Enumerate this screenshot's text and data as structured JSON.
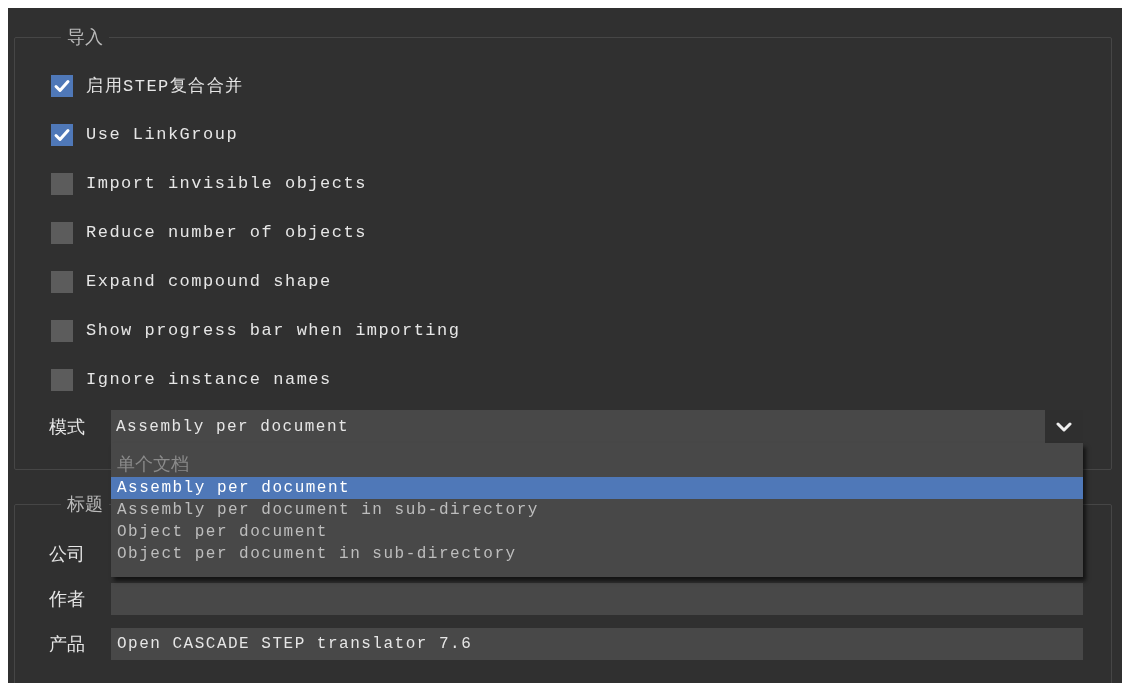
{
  "import": {
    "title": "导入",
    "options": [
      {
        "label": "启用STEP复合合并",
        "checked": true
      },
      {
        "label": "Use LinkGroup",
        "checked": true
      },
      {
        "label": "Import invisible objects",
        "checked": false
      },
      {
        "label": "Reduce number of objects",
        "checked": false
      },
      {
        "label": "Expand compound shape",
        "checked": false
      },
      {
        "label": "Show progress bar when importing",
        "checked": false
      },
      {
        "label": "Ignore instance names",
        "checked": false
      }
    ],
    "mode": {
      "label": "模式",
      "value": "Assembly per document",
      "expanded": true,
      "options": [
        {
          "label": "单个文档",
          "disabled": true,
          "selected": false
        },
        {
          "label": "Assembly per document",
          "disabled": false,
          "selected": true
        },
        {
          "label": "Assembly per document in sub-directory",
          "disabled": false,
          "selected": false
        },
        {
          "label": "Object per document",
          "disabled": false,
          "selected": false
        },
        {
          "label": "Object per document in sub-directory",
          "disabled": false,
          "selected": false
        }
      ]
    }
  },
  "header": {
    "title": "标题",
    "fields": [
      {
        "label": "公司",
        "kind": "label-only"
      },
      {
        "label": "作者",
        "kind": "input"
      },
      {
        "label": "产品",
        "kind": "input",
        "value": "Open CASCADE STEP translator 7.6"
      }
    ]
  }
}
